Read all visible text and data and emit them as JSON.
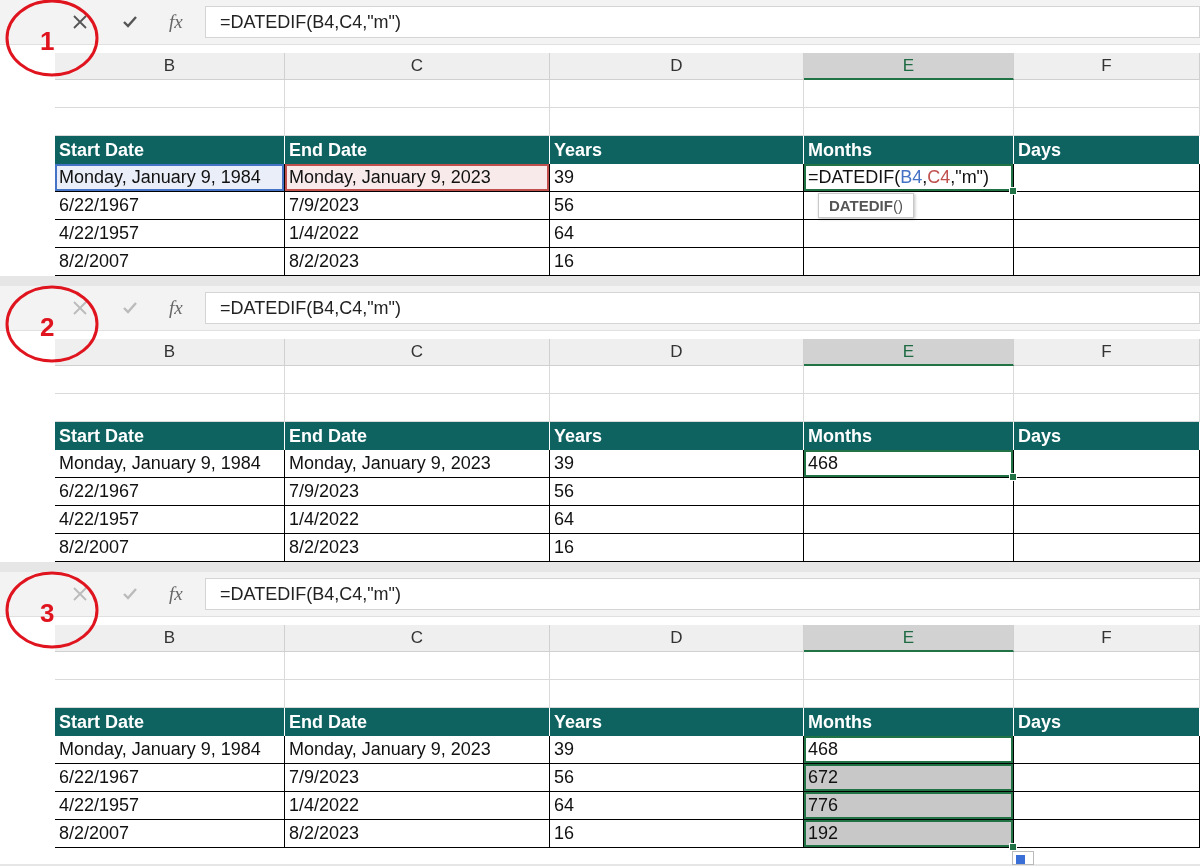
{
  "panels": [
    {
      "annotation": "1",
      "editing": true,
      "fx_label": "fx",
      "formula": "=DATEDIF(B4,C4,\"m\")",
      "column_headers": [
        {
          "label": "B",
          "selected": false
        },
        {
          "label": "C",
          "selected": false
        },
        {
          "label": "D",
          "selected": false
        },
        {
          "label": "E",
          "selected": true
        },
        {
          "label": "F",
          "selected": false
        }
      ],
      "table_header": [
        "Start Date",
        "End Date",
        "Years",
        "Months",
        "Days"
      ],
      "rows": [
        {
          "cells": [
            {
              "text": "Monday, January 9, 1984",
              "selected": false,
              "highlighted": false,
              "color": "#4472c4"
            },
            {
              "text": "Monday, January 9, 2023",
              "selected": false,
              "highlighted": false,
              "color": "#c0504d"
            },
            {
              "text": "39",
              "selected": false,
              "highlighted": false
            },
            {
              "segments": [
                {
                  "text": "=DATEDIF("
                },
                {
                  "text": "B4",
                  "color": "#4472c4"
                },
                {
                  "text": ","
                },
                {
                  "text": "C4",
                  "color": "#c0504d"
                },
                {
                  "text": ",\"m\")"
                }
              ],
              "selected": true,
              "highlighted": false
            },
            {
              "selected": false,
              "highlighted": false
            }
          ]
        },
        {
          "cells": [
            {
              "text": "6/22/1967",
              "selected": false,
              "highlighted": false
            },
            {
              "text": "7/9/2023",
              "selected": false,
              "highlighted": false
            },
            {
              "text": "56",
              "selected": false,
              "highlighted": false
            },
            {
              "selected": false,
              "highlighted": false
            },
            {
              "selected": false,
              "highlighted": false
            }
          ]
        },
        {
          "cells": [
            {
              "text": "4/22/1957",
              "selected": false,
              "highlighted": false
            },
            {
              "text": "1/4/2022",
              "selected": false,
              "highlighted": false
            },
            {
              "text": "64",
              "selected": false,
              "highlighted": false
            },
            {
              "selected": false,
              "highlighted": false
            },
            {
              "selected": false,
              "highlighted": false
            }
          ]
        },
        {
          "cells": [
            {
              "text": "8/2/2007",
              "selected": false,
              "highlighted": false
            },
            {
              "text": "8/2/2023",
              "selected": false,
              "highlighted": false
            },
            {
              "text": "16",
              "selected": false,
              "highlighted": false
            },
            {
              "selected": false,
              "highlighted": false
            },
            {
              "selected": false,
              "highlighted": false
            }
          ]
        }
      ],
      "tooltip": "**DATEDIF**()"
    },
    {
      "annotation": "2",
      "editing": false,
      "fx_label": "fx",
      "formula": "=DATEDIF(B4,C4,\"m\")",
      "column_headers": [
        {
          "label": "B",
          "selected": false
        },
        {
          "label": "C",
          "selected": false
        },
        {
          "label": "D",
          "selected": false
        },
        {
          "label": "E",
          "selected": true
        },
        {
          "label": "F",
          "selected": false
        }
      ],
      "table_header": [
        "Start Date",
        "End Date",
        "Years",
        "Months",
        "Days"
      ],
      "rows": [
        {
          "cells": [
            {
              "text": "Monday, January 9, 1984",
              "selected": false,
              "highlighted": false
            },
            {
              "text": "Monday, January 9, 2023",
              "selected": false,
              "highlighted": false
            },
            {
              "text": "39",
              "selected": false,
              "highlighted": false
            },
            {
              "text": "468",
              "selected": true,
              "highlighted": false
            },
            {
              "selected": false,
              "highlighted": false
            }
          ]
        },
        {
          "cells": [
            {
              "text": "6/22/1967",
              "selected": false,
              "highlighted": false
            },
            {
              "text": "7/9/2023",
              "selected": false,
              "highlighted": false
            },
            {
              "text": "56",
              "selected": false,
              "highlighted": false
            },
            {
              "selected": false,
              "highlighted": false
            },
            {
              "selected": false,
              "highlighted": false
            }
          ]
        },
        {
          "cells": [
            {
              "text": "4/22/1957",
              "selected": false,
              "highlighted": false
            },
            {
              "text": "1/4/2022",
              "selected": false,
              "highlighted": false
            },
            {
              "text": "64",
              "selected": false,
              "highlighted": false
            },
            {
              "selected": false,
              "highlighted": false
            },
            {
              "selected": false,
              "highlighted": false
            }
          ]
        },
        {
          "cells": [
            {
              "text": "8/2/2007",
              "selected": false,
              "highlighted": false
            },
            {
              "text": "8/2/2023",
              "selected": false,
              "highlighted": false
            },
            {
              "text": "16",
              "selected": false,
              "highlighted": false
            },
            {
              "selected": false,
              "highlighted": false
            },
            {
              "selected": false,
              "highlighted": false
            }
          ]
        }
      ]
    },
    {
      "annotation": "3",
      "editing": false,
      "fx_label": "fx",
      "formula": "=DATEDIF(B4,C4,\"m\")",
      "column_headers": [
        {
          "label": "B",
          "selected": false
        },
        {
          "label": "C",
          "selected": false
        },
        {
          "label": "D",
          "selected": false
        },
        {
          "label": "E",
          "selected": true
        },
        {
          "label": "F",
          "selected": false
        }
      ],
      "table_header": [
        "Start Date",
        "End Date",
        "Years",
        "Months",
        "Days"
      ],
      "rows": [
        {
          "cells": [
            {
              "text": "Monday, January 9, 1984",
              "selected": false,
              "highlighted": false
            },
            {
              "text": "Monday, January 9, 2023",
              "selected": false,
              "highlighted": false
            },
            {
              "text": "39",
              "selected": false,
              "highlighted": false
            },
            {
              "text": "468",
              "selected": true,
              "highlighted": false
            },
            {
              "selected": false,
              "highlighted": false
            }
          ]
        },
        {
          "cells": [
            {
              "text": "6/22/1967",
              "selected": false,
              "highlighted": false
            },
            {
              "text": "7/9/2023",
              "selected": false,
              "highlighted": false
            },
            {
              "text": "56",
              "selected": false,
              "highlighted": false
            },
            {
              "text": "672",
              "selected": true,
              "highlighted": true
            },
            {
              "selected": false,
              "highlighted": false
            }
          ]
        },
        {
          "cells": [
            {
              "text": "4/22/1957",
              "selected": false,
              "highlighted": false
            },
            {
              "text": "1/4/2022",
              "selected": false,
              "highlighted": false
            },
            {
              "text": "64",
              "selected": false,
              "highlighted": false
            },
            {
              "text": "776",
              "selected": true,
              "highlighted": true
            },
            {
              "selected": false,
              "highlighted": false
            }
          ]
        },
        {
          "cells": [
            {
              "text": "8/2/2007",
              "selected": false,
              "highlighted": false
            },
            {
              "text": "8/2/2023",
              "selected": false,
              "highlighted": false
            },
            {
              "text": "16",
              "selected": false,
              "highlighted": false
            },
            {
              "text": "192",
              "selected": true,
              "highlighted": true
            },
            {
              "selected": false,
              "highlighted": false
            }
          ]
        }
      ]
    }
  ]
}
